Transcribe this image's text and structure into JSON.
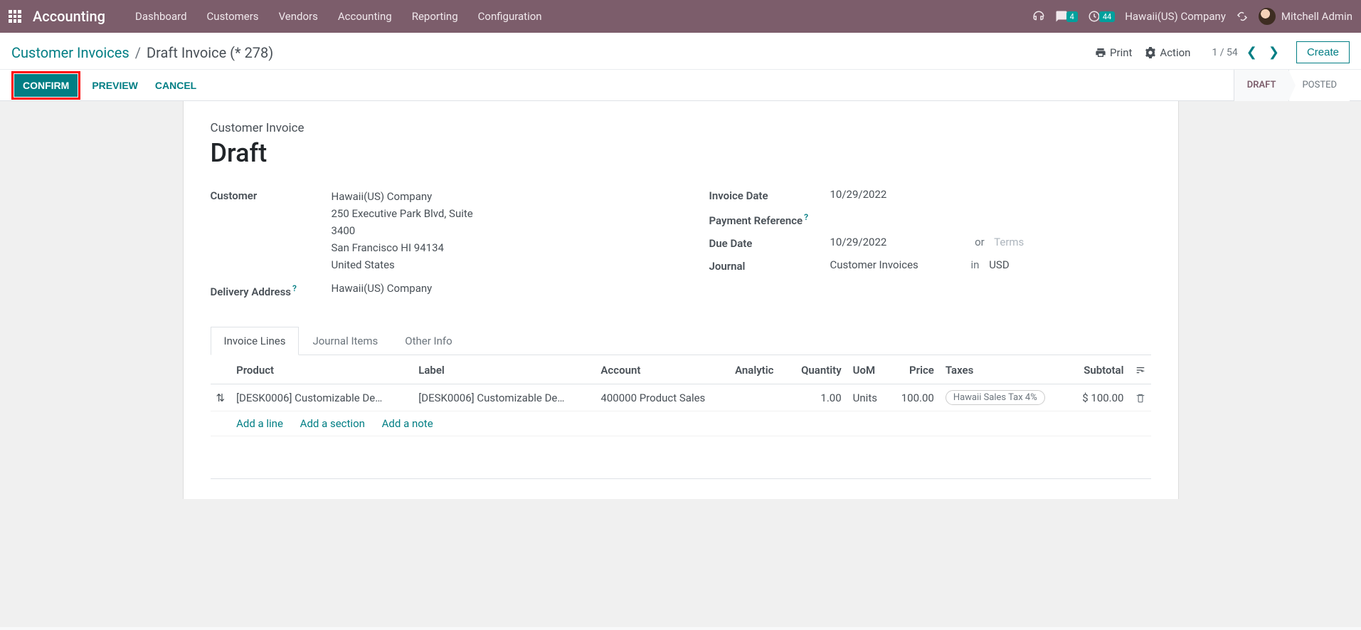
{
  "topnav": {
    "brand": "Accounting",
    "items": [
      "Dashboard",
      "Customers",
      "Vendors",
      "Accounting",
      "Reporting",
      "Configuration"
    ],
    "msg_badge": "4",
    "act_badge": "44",
    "company": "Hawaii(US) Company",
    "user": "Mitchell Admin"
  },
  "breadcrumb": {
    "parent": "Customer Invoices",
    "current": "Draft Invoice (* 278)"
  },
  "cp": {
    "print": "Print",
    "action": "Action",
    "pager": "1 / 54",
    "create": "Create"
  },
  "statusbar": {
    "confirm": "CONFIRM",
    "preview": "PREVIEW",
    "cancel": "CANCEL",
    "steps": [
      "DRAFT",
      "POSTED"
    ]
  },
  "doc": {
    "type": "Customer Invoice",
    "title": "Draft"
  },
  "fields": {
    "customer_label": "Customer",
    "customer_name": "Hawaii(US) Company",
    "customer_addr1": "250 Executive Park Blvd, Suite 3400",
    "customer_addr2": "San Francisco HI 94134",
    "customer_addr3": "United States",
    "delivery_label": "Delivery Address",
    "delivery_value": "Hawaii(US) Company",
    "invoice_date_label": "Invoice Date",
    "invoice_date": "10/29/2022",
    "payment_ref_label": "Payment Reference",
    "due_date_label": "Due Date",
    "due_date": "10/29/2022",
    "or": "or",
    "terms_placeholder": "Terms",
    "journal_label": "Journal",
    "journal": "Customer Invoices",
    "in": "in",
    "currency": "USD"
  },
  "tabs": [
    "Invoice Lines",
    "Journal Items",
    "Other Info"
  ],
  "table": {
    "headers": [
      "Product",
      "Label",
      "Account",
      "Analytic",
      "Quantity",
      "UoM",
      "Price",
      "Taxes",
      "Subtotal"
    ],
    "row": {
      "product": "[DESK0006] Customizable De…",
      "label": "[DESK0006] Customizable De…",
      "account": "400000 Product Sales",
      "analytic": "",
      "quantity": "1.00",
      "uom": "Units",
      "price": "100.00",
      "tax": "Hawaii Sales Tax 4%",
      "subtotal": "$ 100.00"
    },
    "add_line": "Add a line",
    "add_section": "Add a section",
    "add_note": "Add a note"
  }
}
